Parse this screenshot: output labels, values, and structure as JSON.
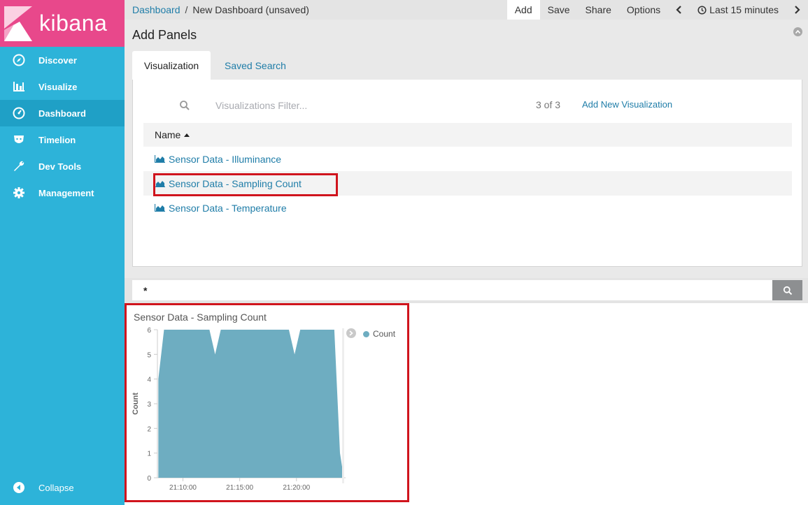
{
  "app": {
    "logo_text": "kibana"
  },
  "sidebar": {
    "items": [
      {
        "label": "Discover"
      },
      {
        "label": "Visualize"
      },
      {
        "label": "Dashboard"
      },
      {
        "label": "Timelion"
      },
      {
        "label": "Dev Tools"
      },
      {
        "label": "Management"
      }
    ],
    "collapse_label": "Collapse"
  },
  "topbar": {
    "breadcrumb_root": "Dashboard",
    "breadcrumb_sep": "/",
    "breadcrumb_current": "New Dashboard (unsaved)",
    "add_label": "Add",
    "save_label": "Save",
    "share_label": "Share",
    "options_label": "Options",
    "time_label": "Last 15 minutes"
  },
  "add_panels": {
    "title": "Add Panels",
    "tabs": [
      {
        "label": "Visualization"
      },
      {
        "label": "Saved Search"
      }
    ],
    "filter_placeholder": "Visualizations Filter...",
    "count": "3 of 3",
    "add_new_label": "Add New Visualization",
    "column_name": "Name",
    "visualizations": [
      {
        "label": "Sensor Data - Illuminance"
      },
      {
        "label": "Sensor Data - Sampling Count"
      },
      {
        "label": "Sensor Data - Temperature"
      }
    ]
  },
  "query": {
    "value": "*"
  },
  "panel": {
    "title": "Sensor Data - Sampling Count"
  },
  "colors": {
    "accent": "#2db3d9",
    "brand": "#e8488b",
    "series": "#6eadc1",
    "highlight": "#d0141d"
  },
  "chart_data": {
    "type": "area",
    "ylabel": "Count",
    "xlabel": "",
    "ylim": [
      0,
      6
    ],
    "yticks": [
      0,
      1,
      2,
      3,
      4,
      5,
      6
    ],
    "xticks": [
      "21:10:00",
      "21:15:00",
      "21:20:00"
    ],
    "series": [
      {
        "name": "Count",
        "x": [
          "21:07:50",
          "21:08:20",
          "21:12:20",
          "21:12:50",
          "21:13:20",
          "21:19:20",
          "21:19:50",
          "21:20:20",
          "21:23:20",
          "21:23:50",
          "21:24:10"
        ],
        "values": [
          4,
          6,
          6,
          5,
          6,
          6,
          5,
          6,
          6,
          1,
          0
        ]
      }
    ]
  }
}
